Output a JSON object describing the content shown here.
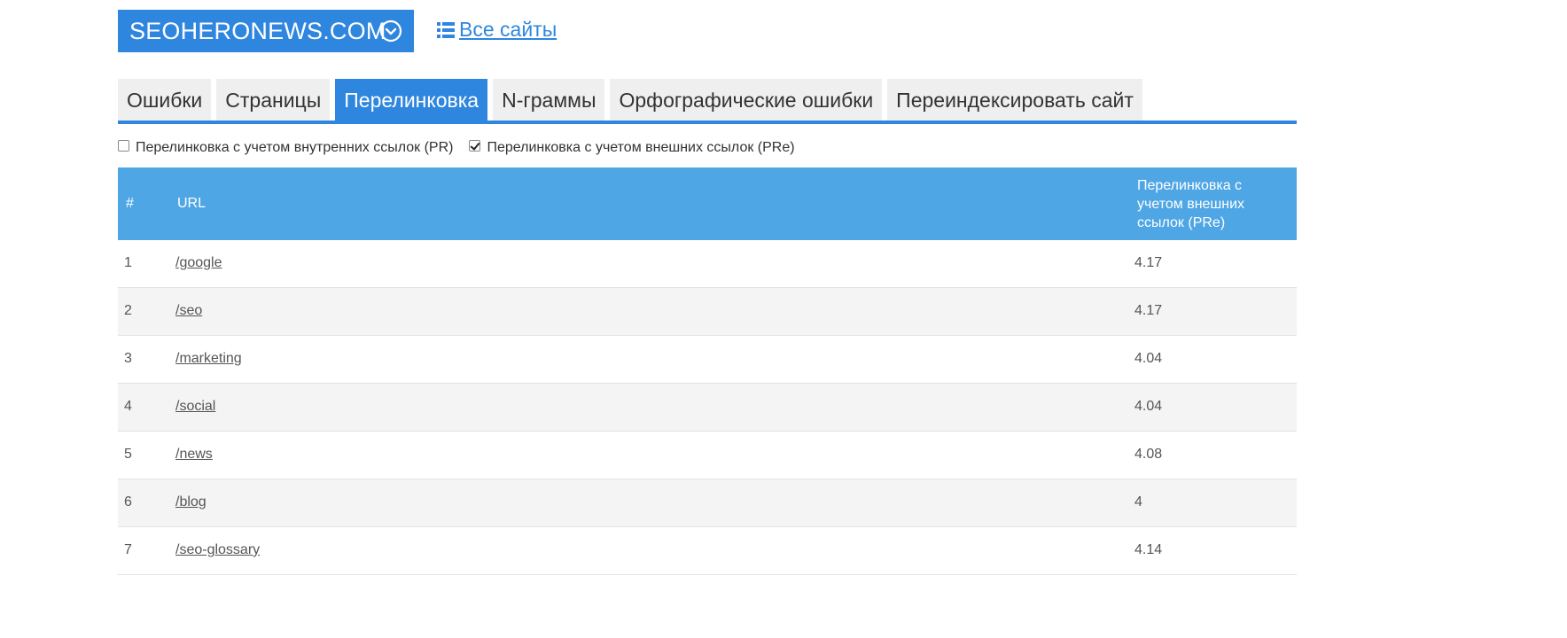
{
  "header": {
    "site_name": "SEOHERONEWS.COM",
    "all_sites_label": "Все сайты"
  },
  "tabs": [
    {
      "label": "Ошибки",
      "active": false
    },
    {
      "label": "Страницы",
      "active": false
    },
    {
      "label": "Перелинковка",
      "active": true
    },
    {
      "label": "N-граммы",
      "active": false
    },
    {
      "label": "Орфографические ошибки",
      "active": false
    },
    {
      "label": "Переиндексировать сайт",
      "active": false
    }
  ],
  "options": [
    {
      "label": "Перелинковка с учетом внутренних ссылок (PR)",
      "checked": false
    },
    {
      "label": "Перелинковка с учетом внешних ссылок (PRe)",
      "checked": true
    }
  ],
  "table": {
    "headers": {
      "num": "#",
      "url": "URL",
      "pre": "Перелинковка с учетом внешних ссылок (PRe)"
    },
    "rows": [
      {
        "num": "1",
        "url": "/google",
        "value": "4.17"
      },
      {
        "num": "2",
        "url": "/seo",
        "value": "4.17"
      },
      {
        "num": "3",
        "url": "/marketing",
        "value": "4.04"
      },
      {
        "num": "4",
        "url": "/social",
        "value": "4.04"
      },
      {
        "num": "5",
        "url": "/news",
        "value": "4.08"
      },
      {
        "num": "6",
        "url": "/blog",
        "value": "4"
      },
      {
        "num": "7",
        "url": "/seo-glossary",
        "value": "4.14"
      }
    ]
  },
  "colors": {
    "accent": "#2f86de",
    "table_header": "#4fa6e5",
    "tab_bg": "#efefef",
    "row_alt": "#f4f4f4"
  },
  "icons": {
    "site_dropdown": "chevron-down-circle-icon",
    "all_sites": "list-icon"
  }
}
